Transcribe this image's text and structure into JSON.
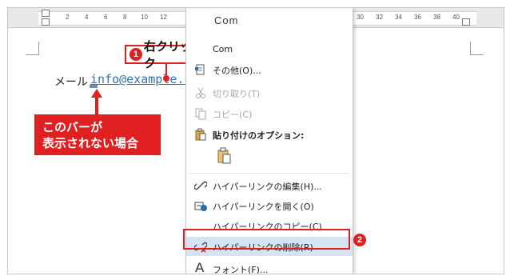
{
  "ruler": {
    "ticks": [
      "2",
      "4",
      "6",
      "8",
      "10",
      "12",
      "30",
      "32",
      "34",
      "36",
      "38",
      "40"
    ]
  },
  "document": {
    "mail_label": "メール",
    "link_text": "info@example.com"
  },
  "annotations": {
    "callout1_num": "1",
    "callout1_text": "右クリック",
    "note_line1": "このバーが",
    "note_line2": "表示されない場合",
    "callout2_num": "2"
  },
  "context_menu": {
    "mini_bar_text": "Com",
    "items": [
      {
        "label": "Com",
        "icon": "none",
        "enabled": true
      },
      {
        "label": "その他(O)...",
        "icon": "document-icon",
        "enabled": true
      },
      {
        "label": "切り取り(T)",
        "icon": "scissors-icon",
        "enabled": false
      },
      {
        "label": "コピー(C)",
        "icon": "copy-icon",
        "enabled": false
      },
      {
        "label": "貼り付けのオプション:",
        "icon": "clipboard-icon",
        "enabled": true
      },
      {
        "label": "ハイパーリンクの編集(H)...",
        "icon": "link-edit-icon",
        "enabled": true
      },
      {
        "label": "ハイパーリンクを開く(O)",
        "icon": "link-open-icon",
        "enabled": true
      },
      {
        "label": "ハイパーリンクのコピー(C)",
        "icon": "none",
        "enabled": true
      },
      {
        "label": "ハイパーリンクの削除(R)",
        "icon": "link-remove-icon",
        "enabled": true
      },
      {
        "label": "フォント(F)...",
        "icon": "font-icon",
        "enabled": true
      }
    ]
  },
  "colors": {
    "accent_red": "#e02020",
    "link_blue": "#2e74b5",
    "menu_highlight": "#d5e3f5"
  }
}
